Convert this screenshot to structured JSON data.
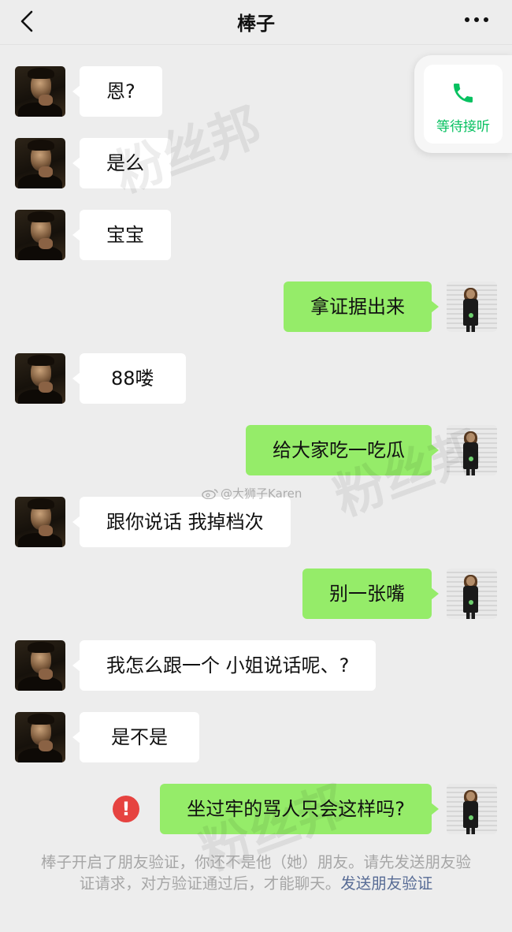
{
  "header": {
    "title": "棒子"
  },
  "call_card": {
    "status_label": "等待接听"
  },
  "messages": [
    {
      "side": "in",
      "text": "恩?"
    },
    {
      "side": "in",
      "text": "是么"
    },
    {
      "side": "in",
      "text": "宝宝"
    },
    {
      "side": "out",
      "text": "拿证据出来"
    },
    {
      "side": "in",
      "text": "88喽"
    },
    {
      "side": "out",
      "text": "给大家吃一吃瓜"
    },
    {
      "side": "in",
      "text": "跟你说话 我掉档次"
    },
    {
      "side": "out",
      "text": "别一张嘴"
    },
    {
      "side": "in",
      "text": "我怎么跟一个 小姐说话呢、?"
    },
    {
      "side": "in",
      "text": "是不是"
    },
    {
      "side": "out",
      "text": "坐过牢的骂人只会这样吗?",
      "failed": true
    }
  ],
  "error_mark": "!",
  "watermarks": {
    "brand": "粉丝邦",
    "weibo_handle": "@大狮子Karen"
  },
  "system_note": {
    "text": "棒子开启了朋友验证，你还不是他（她）朋友。请先发送朋友验证请求，对方验证通过后，才能聊天。",
    "link_text": "发送朋友验证"
  },
  "colors": {
    "background": "#ededed",
    "bubble_out": "#95ec69",
    "bubble_in": "#ffffff",
    "call_green": "#07c160",
    "error_red": "#e64340",
    "link_blue": "#576b95"
  }
}
